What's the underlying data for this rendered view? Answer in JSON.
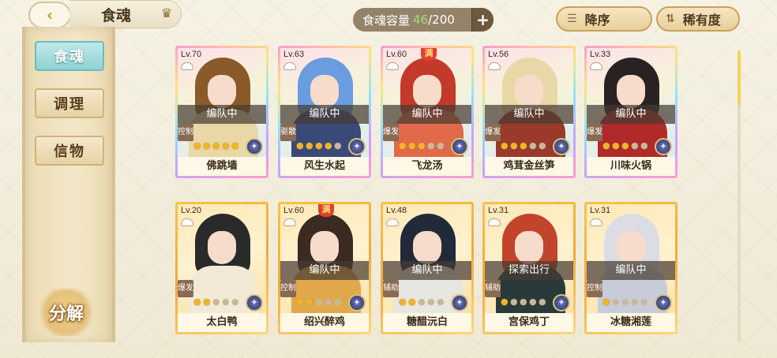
{
  "header": {
    "back_glyph": "‹",
    "title": "食魂",
    "capacity": {
      "label": "食魂容量",
      "current": "46",
      "max": "/200",
      "add_glyph": "+"
    },
    "sort_desc": {
      "icon": "☰",
      "label": "降序"
    },
    "sort_rarity": {
      "icon": "⇅",
      "label": "稀有度"
    }
  },
  "sidebar": {
    "items": [
      {
        "label": "食魂"
      },
      {
        "label": "调理"
      },
      {
        "label": "信物"
      }
    ],
    "decompose_label": "分解"
  },
  "cards": [
    {
      "level": "Lv.70",
      "status": "编队中",
      "role": "控制",
      "name": "佛跳墙",
      "frame": "rainbow",
      "stars": 5,
      "max": false,
      "hair": "#8a5a2a",
      "outfit": "#e9d8a6"
    },
    {
      "level": "Lv.63",
      "status": "编队中",
      "role": "驱散",
      "name": "风生水起",
      "frame": "rainbow",
      "stars": 4,
      "max": false,
      "hair": "#6a9ce0",
      "outfit": "#3a4a78"
    },
    {
      "level": "Lv.60",
      "status": "编队中",
      "role": "爆发",
      "name": "飞龙汤",
      "frame": "rainbow",
      "stars": 3,
      "max": true,
      "hair": "#c43a2a",
      "outfit": "#e06a4a"
    },
    {
      "level": "Lv.56",
      "status": "编队中",
      "role": "爆发",
      "name": "鸡茸金丝笋",
      "frame": "rainbow",
      "stars": 3,
      "max": false,
      "hair": "#e8d8a8",
      "outfit": "#9a3a2a"
    },
    {
      "level": "Lv.33",
      "status": "编队中",
      "role": "爆发",
      "name": "川味火锅",
      "frame": "rainbow",
      "stars": 3,
      "max": false,
      "hair": "#2a2222",
      "outfit": "#b02a2a"
    },
    {
      "level": "Lv.20",
      "status": "",
      "role": "爆发",
      "name": "太白鸭",
      "frame": "gold",
      "stars": 2,
      "max": false,
      "hair": "#2a2a2a",
      "outfit": "#f2ead6"
    },
    {
      "level": "Lv.60",
      "status": "编队中",
      "role": "控制",
      "name": "绍兴醉鸡",
      "frame": "gold",
      "stars": 2,
      "max": true,
      "hair": "#3a2a22",
      "outfit": "#e0a84a"
    },
    {
      "level": "Lv.48",
      "status": "编队中",
      "role": "辅助",
      "name": "糖醋沅白",
      "frame": "gold",
      "stars": 2,
      "max": false,
      "hair": "#222a3a",
      "outfit": "#e8e6e0"
    },
    {
      "level": "Lv.31",
      "status": "探索出行",
      "role": "辅助",
      "name": "宫保鸡丁",
      "frame": "gold",
      "stars": 1,
      "max": false,
      "hair": "#c2442a",
      "outfit": "#2a3a3a"
    },
    {
      "level": "Lv.31",
      "status": "编队中",
      "role": "控制",
      "name": "冰糖湘莲",
      "frame": "gold",
      "stars": 1,
      "max": false,
      "hair": "#dcdce4",
      "outfit": "#c8ccd8"
    }
  ],
  "max_badge": "满",
  "scroll_fraction": 0.19
}
